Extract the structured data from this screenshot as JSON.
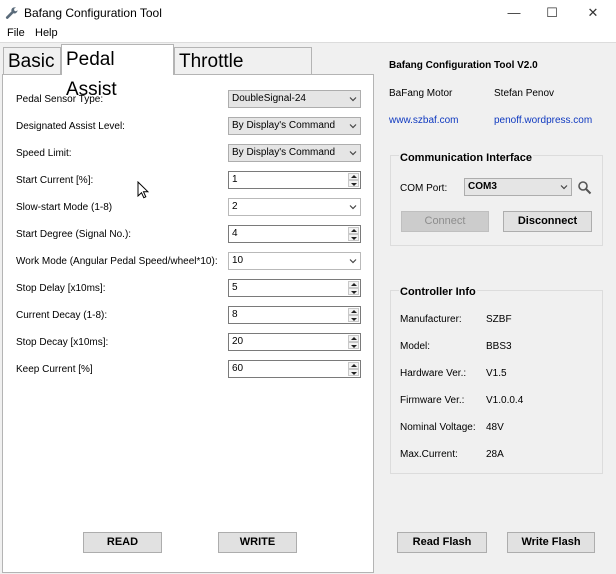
{
  "window": {
    "title": "Bafang Configuration Tool",
    "minimize_glyph": "—",
    "maximize_glyph": "☐",
    "close_glyph": "✕"
  },
  "menu": {
    "items": [
      "File",
      "Help"
    ]
  },
  "tabs": [
    {
      "label": "Basic",
      "active": false
    },
    {
      "label": "Pedal Assist",
      "active": true
    },
    {
      "label": "Throttle Handle",
      "active": false
    }
  ],
  "pedal_assist": {
    "fields": [
      {
        "label": "Pedal Sensor Type:",
        "kind": "combo",
        "value": "DoubleSignal-24"
      },
      {
        "label": "Designated Assist Level:",
        "kind": "combo",
        "value": "By Display's Command"
      },
      {
        "label": "Speed Limit:",
        "kind": "combo",
        "value": "By Display's Command"
      },
      {
        "label": "Start Current [%]:",
        "kind": "spin",
        "value": "1"
      },
      {
        "label": "Slow-start Mode (1-8)",
        "kind": "combo-white",
        "value": "2"
      },
      {
        "label": "Start Degree (Signal No.):",
        "kind": "spin",
        "value": "4"
      },
      {
        "label": "Work Mode (Angular Pedal Speed/wheel*10):",
        "kind": "combo-white",
        "value": "10"
      },
      {
        "label": "Stop Delay [x10ms]:",
        "kind": "spin",
        "value": "5"
      },
      {
        "label": "Current Decay (1-8):",
        "kind": "spin",
        "value": "8"
      },
      {
        "label": "Stop Decay [x10ms]:",
        "kind": "spin",
        "value": "20"
      },
      {
        "label": "Keep Current [%]",
        "kind": "spin",
        "value": "60"
      }
    ],
    "read_label": "READ",
    "write_label": "WRITE"
  },
  "about": {
    "heading": "Bafang Configuration Tool V2.0",
    "vendor": "BaFang Motor",
    "author": "Stefan Penov",
    "vendor_link": "www.szbaf.com",
    "author_link": "penoff.wordpress.com"
  },
  "comm": {
    "title": "Communication Interface",
    "port_label": "COM Port:",
    "port_value": "COM3",
    "connect_label": "Connect",
    "disconnect_label": "Disconnect"
  },
  "controller": {
    "title": "Controller Info",
    "rows": [
      {
        "label": "Manufacturer:",
        "value": "SZBF"
      },
      {
        "label": "Model:",
        "value": "BBS3"
      },
      {
        "label": "Hardware Ver.:",
        "value": "V1.5"
      },
      {
        "label": "Firmware Ver.:",
        "value": "V1.0.0.4"
      },
      {
        "label": "Nominal Voltage:",
        "value": "48V"
      },
      {
        "label": "Max.Current:",
        "value": "28A"
      }
    ]
  },
  "footer": {
    "read_flash_label": "Read Flash",
    "write_flash_label": "Write Flash"
  },
  "colors": {
    "link": "#0f39c0",
    "panel": "#f0f0f0"
  }
}
